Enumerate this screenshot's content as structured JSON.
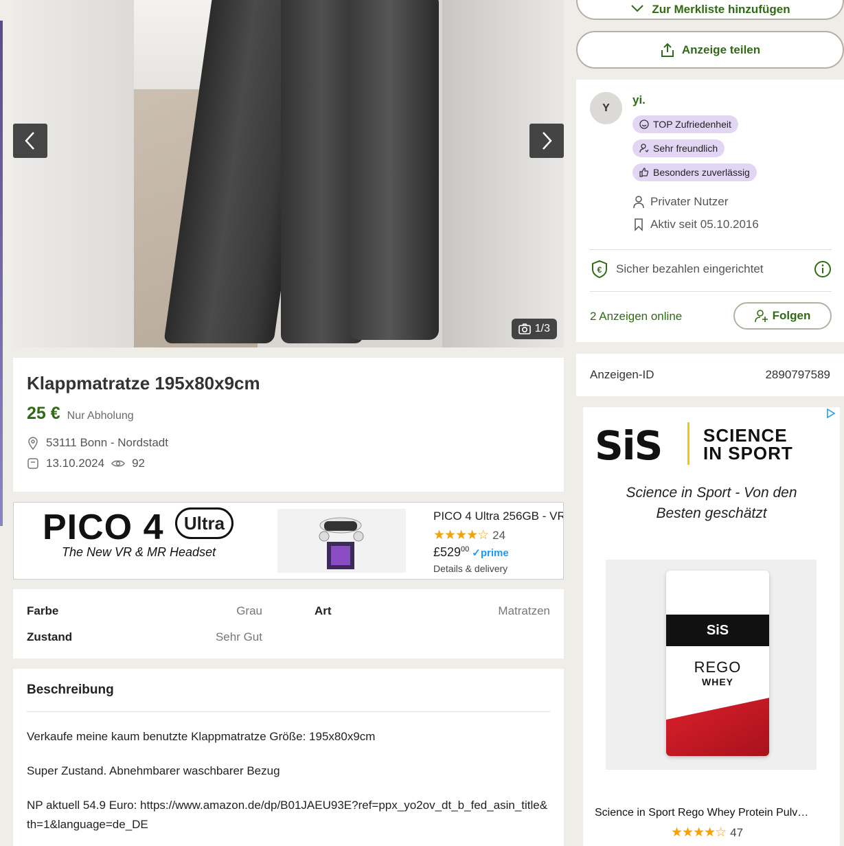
{
  "gallery": {
    "counter": "1/3"
  },
  "listing": {
    "title": "Klappmatratze 195x80x9cm",
    "price": "25 €",
    "price_note": "Nur Abholung",
    "location": "53111 Bonn - Nordstadt",
    "date": "13.10.2024",
    "views": "92"
  },
  "ad_banner": {
    "brand": "PICO 4",
    "brand_badge": "Ultra",
    "tagline": "The New VR & MR Headset",
    "product_title": "PICO 4 Ultra 256GB - VR",
    "rating_count": "24",
    "price": "£529",
    "price_cents": "00",
    "prime": "prime",
    "details": "Details & delivery"
  },
  "attributes": {
    "farbe_label": "Farbe",
    "farbe_value": "Grau",
    "art_label": "Art",
    "art_value": "Matratzen",
    "zustand_label": "Zustand",
    "zustand_value": "Sehr Gut"
  },
  "description": {
    "heading": "Beschreibung",
    "line1": "Verkaufe meine kaum benutzte Klappmatratze Größe: 195x80x9cm",
    "line2": "Super Zustand. Abnehmbarer waschbarer Bezug",
    "line3": "NP aktuell 54.9 Euro: https://www.amazon.de/dp/B01JAEU93E?ref=ppx_yo2ov_dt_b_fed_asin_title&th=1&language=de_DE"
  },
  "actions": {
    "watchlist": "Zur Merkliste hinzufügen",
    "share": "Anzeige teilen"
  },
  "seller": {
    "initial": "Y",
    "name": "yi.",
    "badges": [
      "TOP Zufriedenheit",
      "Sehr freundlich",
      "Besonders zuverlässig"
    ],
    "type": "Privater Nutzer",
    "active_since": "Aktiv seit 05.10.2016",
    "secure_payment": "Sicher bezahlen eingerichtet",
    "ads_online": "2 Anzeigen online",
    "follow": "Folgen"
  },
  "ad_id": {
    "label": "Anzeigen-ID",
    "value": "2890797589"
  },
  "side_ad": {
    "logo": "SiS",
    "brand_line1": "SCIENCE",
    "brand_line2": "IN SPORT",
    "tagline": "Science in Sport - Von den Besten geschätzt",
    "bag_brand": "SiS",
    "bag_product": "REGO",
    "bag_sub": "WHEY",
    "product_title": "Science in Sport Rego Whey Protein Pulv…",
    "rating_count": "47"
  },
  "colors": {
    "accent_green": "#326916",
    "badge_purple": "#e3d6f5",
    "page_bg": "#efede8"
  }
}
